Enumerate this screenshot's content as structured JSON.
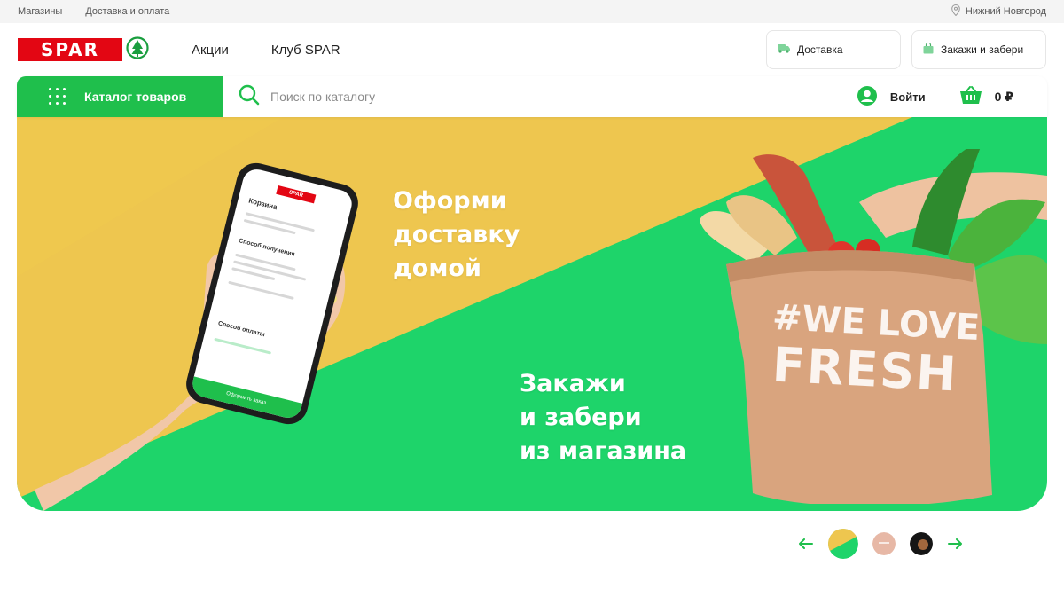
{
  "topbar": {
    "links": [
      "Магазины",
      "Доставка и оплата"
    ],
    "city": "Нижний Новгород"
  },
  "header": {
    "logo_text": "SPAR",
    "nav": [
      "Акции",
      "Клуб SPAR"
    ],
    "delivery_label": "Доставка",
    "pickup_label": "Закажи и забери"
  },
  "search": {
    "catalog_label": "Каталог товаров",
    "placeholder": "Поиск по каталогу",
    "login_label": "Войти",
    "cart_total": "0 ₽"
  },
  "banner": {
    "headline_1": [
      "Оформи",
      "доставку",
      "домой"
    ],
    "headline_2": [
      "Закажи",
      "и забери",
      "из магазина"
    ],
    "bag_line_1": "#WE LOVE",
    "bag_line_2": "FRESH",
    "phone": {
      "logo": "SPAR",
      "title": "Корзина",
      "section_1": "Способ получения",
      "section_2": "Способ оплаты",
      "button": "Оформить заказ"
    }
  },
  "carousel": {
    "prev_icon": "arrow-left-icon",
    "next_icon": "arrow-right-icon",
    "active_index": 0,
    "slides": 3
  },
  "colors": {
    "green": "#1fbf4c",
    "yellow": "#f2c94c",
    "red": "#e30613"
  }
}
